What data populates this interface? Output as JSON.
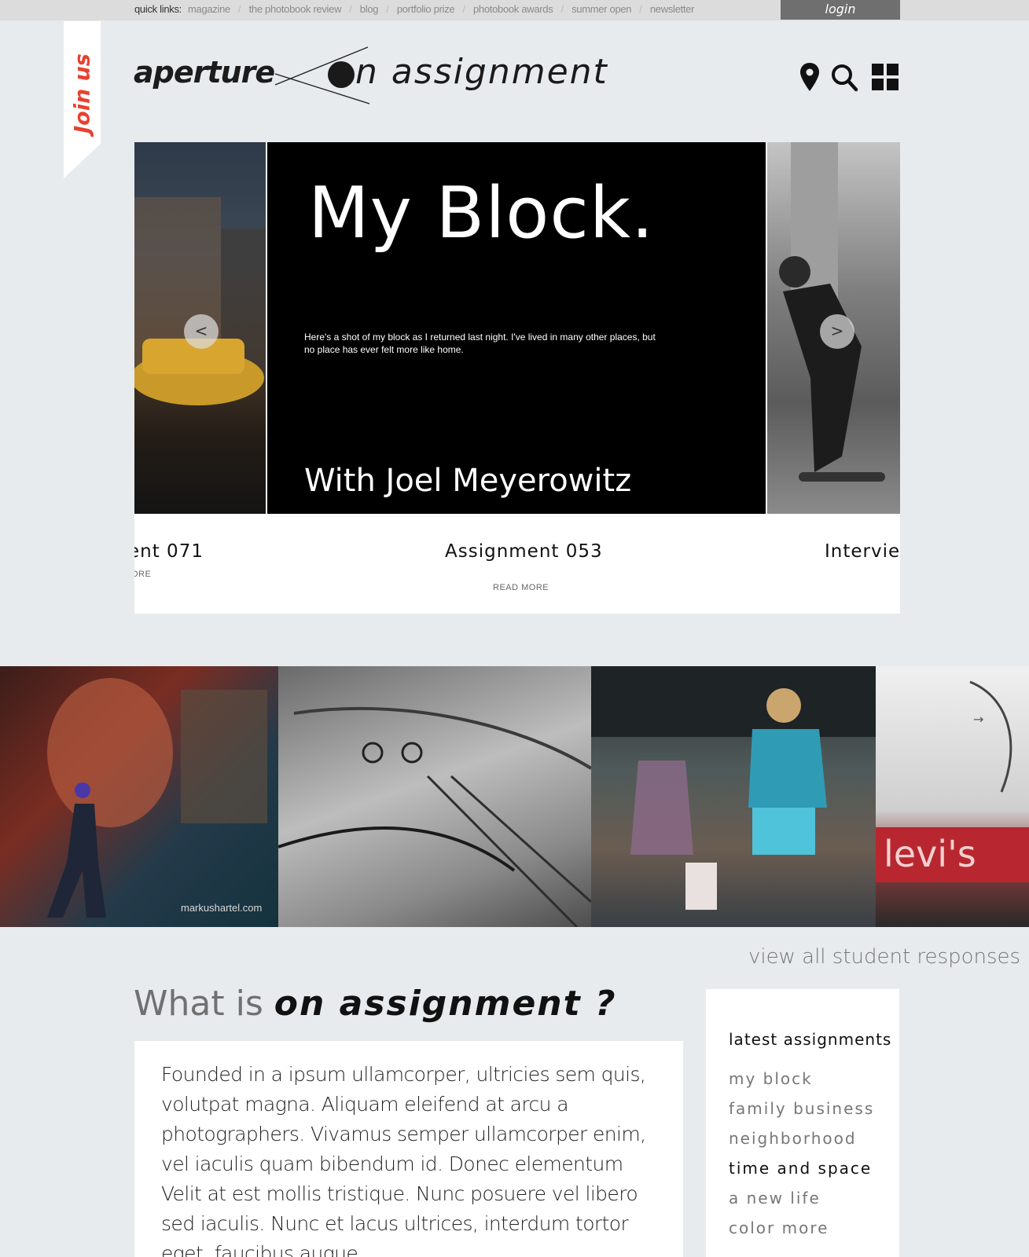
{
  "quick_links": {
    "title": "quick links:",
    "items": [
      "magazine",
      "the photobook review",
      "blog",
      "portfolio prize",
      "photobook awards",
      "summer open",
      "newsletter"
    ]
  },
  "login_label": "login",
  "join_label": "Join us",
  "header": {
    "logo_word": "aperture",
    "logo_tail": "n assignment",
    "icons": [
      "location-pin-icon",
      "search-icon",
      "grid-menu-icon"
    ]
  },
  "carousel": {
    "main": {
      "title": "My Block.",
      "description": "Here's a shot of my block as I returned last night. I've lived in many other places, but no place has ever felt more like home.",
      "with": "With Joel Meyerowitz",
      "caption": "Assignment 053",
      "read_more": "READ MORE"
    },
    "left": {
      "caption": "ent 071",
      "read_more": "ORE"
    },
    "right": {
      "caption": "Interview"
    },
    "prev_arrow": "<",
    "next_arrow": ">"
  },
  "gallery": {
    "watermark": "markushartel.com",
    "next_arrow": "→"
  },
  "view_all": "view all student responses",
  "what_is": {
    "prefix": "What is",
    "emphasis": "on assignment ?",
    "body": "Founded in a ipsum ullamcorper, ultricies sem quis, volutpat magna. Aliquam eleifend at arcu a photographers. Vivamus semper ullamcorper enim, vel iaculis quam bibendum id. Donec elementum Velit at est mollis tristique. Nunc posuere vel libero sed iaculis. Nunc et lacus ultrices, interdum tortor eget, faucibus augue."
  },
  "sidebar": {
    "title": "latest assignments",
    "items": [
      "my block",
      "family business",
      "neighborhood",
      "time and space",
      "a new life",
      "color more"
    ],
    "active_index": 3
  },
  "colors": {
    "accent": "#e8412f",
    "background": "#e7ebee",
    "login_bg": "#6f6f6f"
  }
}
